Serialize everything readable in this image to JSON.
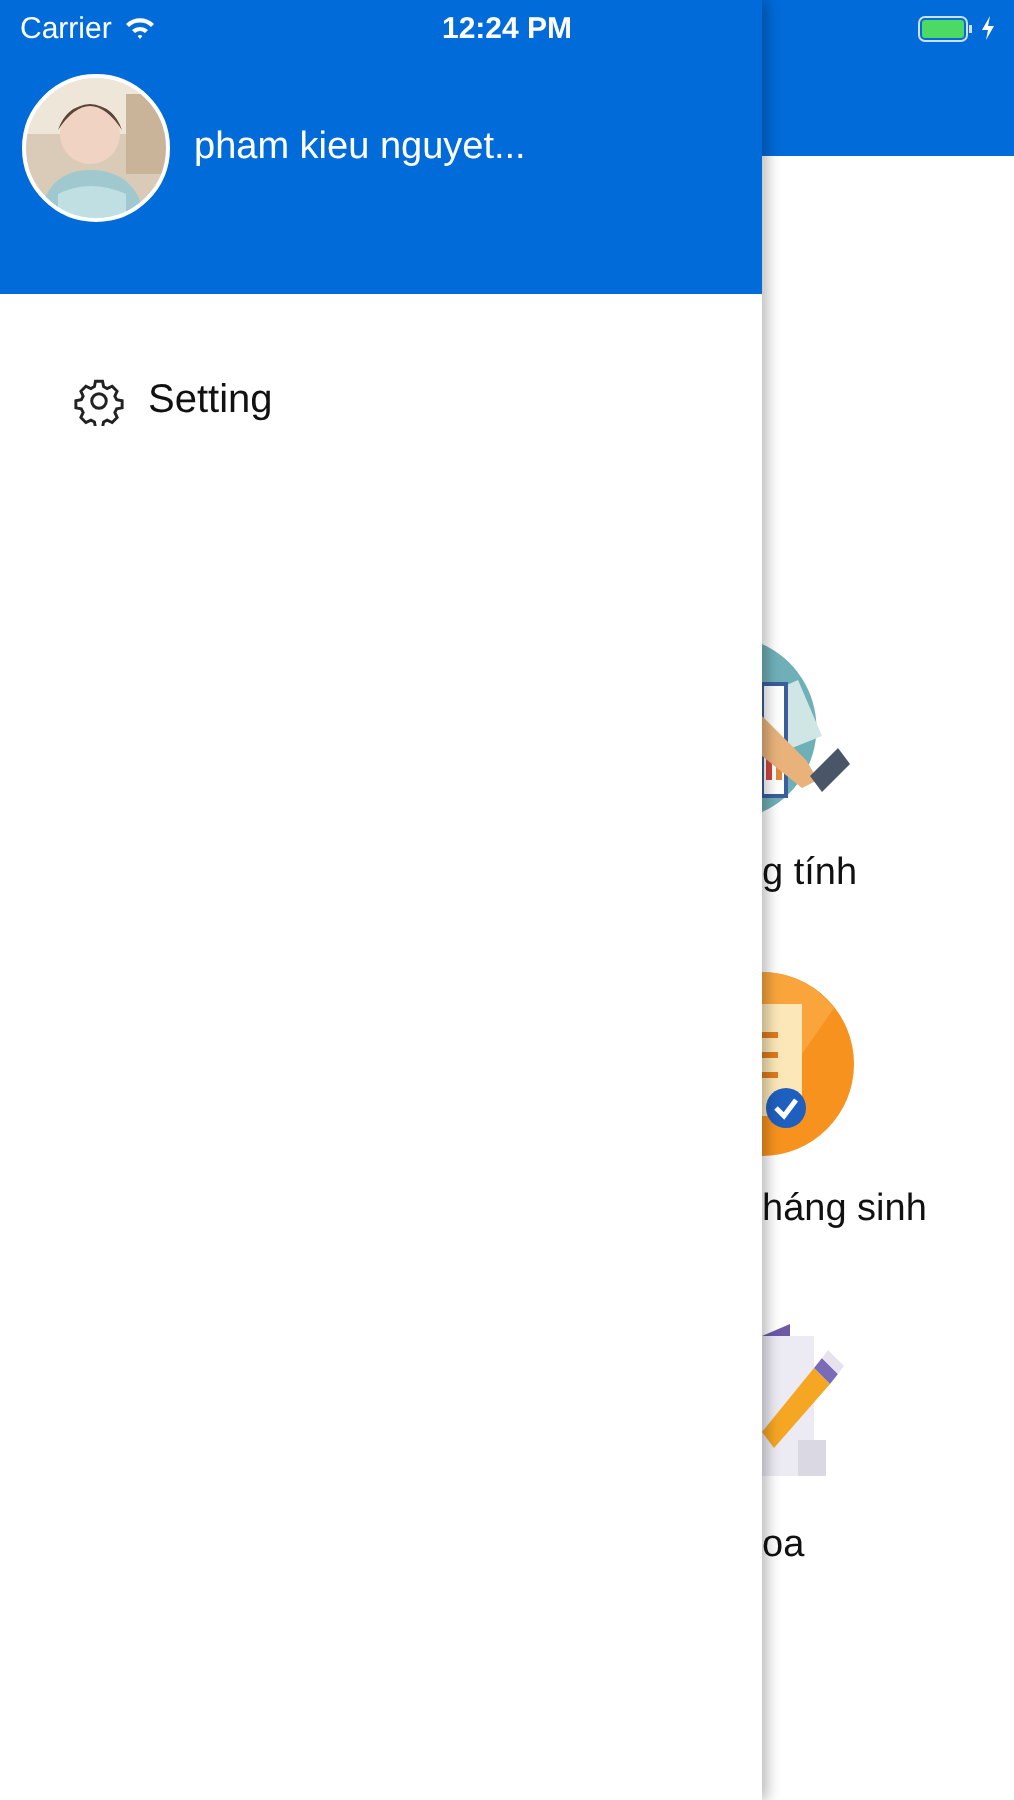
{
  "status_bar": {
    "carrier": "Carrier",
    "time": "12:24 PM",
    "charging": true
  },
  "drawer": {
    "user_name": "pham kieu nguyet...",
    "items": [
      {
        "label": "Setting",
        "kind": "settings"
      }
    ]
  },
  "background_menu": [
    {
      "label": "g tính",
      "kind": "chart"
    },
    {
      "label": "háng sinh",
      "kind": "checklist"
    },
    {
      "label": "oa",
      "kind": "pencil"
    }
  ]
}
